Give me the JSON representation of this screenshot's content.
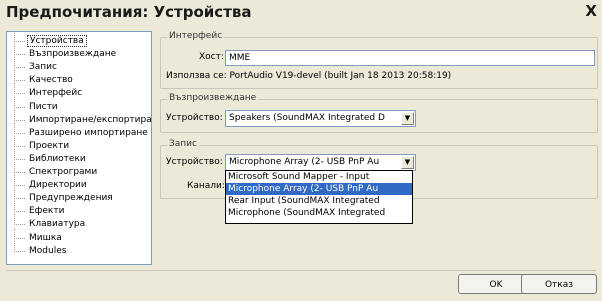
{
  "window": {
    "title": "Предпочитания: Устройства",
    "close_glyph": "X"
  },
  "sidebar": {
    "items": [
      {
        "label": "Устройства",
        "selected": true
      },
      {
        "label": "Възпроизвеждане"
      },
      {
        "label": "Запис"
      },
      {
        "label": "Качество"
      },
      {
        "label": "Интерфейс"
      },
      {
        "label": "Писти"
      },
      {
        "label": "Импортиране/експортиране"
      },
      {
        "label": "Разширено импортиране"
      },
      {
        "label": "Проекти"
      },
      {
        "label": "Библиотеки"
      },
      {
        "label": "Спектрограми"
      },
      {
        "label": "Директории"
      },
      {
        "label": "Предупреждения"
      },
      {
        "label": "Ефекти"
      },
      {
        "label": "Клавиатура"
      },
      {
        "label": "Мишка"
      },
      {
        "label": "Modules"
      }
    ]
  },
  "interface": {
    "title": "Интерфейс",
    "host_label": "Хост:",
    "host_value": "MME",
    "using_text": "Използва се: PortAudio V19-devel (built Jan 18 2013 20:58:19)"
  },
  "playback": {
    "title": "Възпроизвеждане",
    "device_label": "Устройство:",
    "device_value": "Speakers (SoundMAX Integrated D"
  },
  "recording": {
    "title": "Запис",
    "device_label": "Устройство:",
    "device_value": "Microphone Array (2- USB PnP Au",
    "channels_label": "Канали:",
    "dropdown_options": [
      {
        "label": "Microsoft Sound Mapper - Input"
      },
      {
        "label": "Microphone Array (2- USB PnP Au",
        "highlighted": true
      },
      {
        "label": "Rear Input (SoundMAX Integrated"
      },
      {
        "label": "Microphone (SoundMAX Integrated"
      }
    ]
  },
  "buttons": {
    "ok": "OK",
    "cancel": "Отказ"
  },
  "colors": {
    "highlight": "#316ac5",
    "background": "#ece9d8"
  }
}
